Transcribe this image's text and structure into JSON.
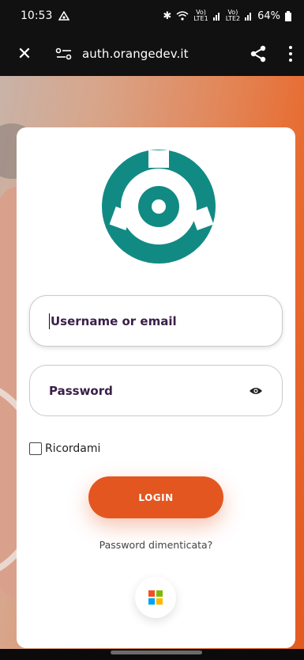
{
  "status_bar": {
    "time": "10:53",
    "battery": "64%",
    "sim1_top": "Vo)",
    "sim1_bottom": "LTE1",
    "sim2_top": "Vo)",
    "sim2_bottom": "LTE2"
  },
  "browser": {
    "url": "auth.orangedev.it"
  },
  "form": {
    "username_label": "Username or email",
    "password_label": "Password",
    "remember_label": "Ricordami",
    "login_label": "LOGIN",
    "forgot_label": "Password dimenticata?"
  },
  "colors": {
    "logo_teal": "#128a84",
    "accent_orange": "#e4561f"
  },
  "icons": [
    "close-icon",
    "site-settings-icon",
    "share-icon",
    "menu-icon",
    "eye-icon",
    "microsoft-icon",
    "logo-icon"
  ]
}
